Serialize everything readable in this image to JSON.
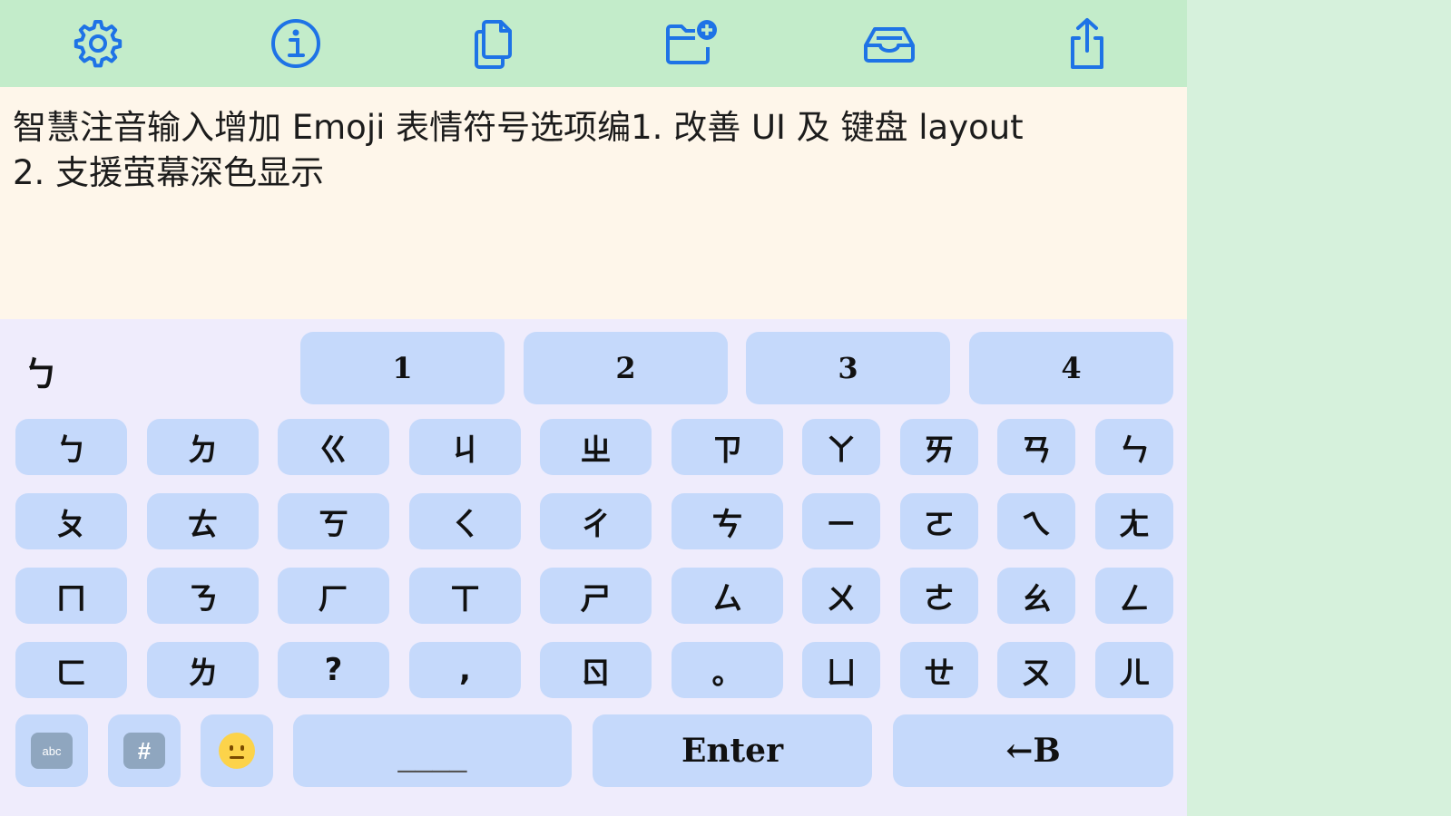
{
  "toolbar": {
    "icons": [
      "gear-icon",
      "info-icon",
      "copy-icon",
      "folder-add-icon",
      "tray-icon",
      "share-icon"
    ],
    "accent_color": "#1e73e6"
  },
  "text_area": {
    "content": "智慧注音输入增加 Emoji 表情符号选项编1. 改善 UI 及 键盘 layout\n2. 支援萤幕深色显示"
  },
  "keyboard": {
    "composition": "ㄅ",
    "candidates": [
      "1",
      "2",
      "3",
      "4"
    ],
    "rows": [
      [
        "ㄅ",
        "ㄉ",
        "ㄍ",
        "ㄐ",
        "ㄓ",
        "ㄗ",
        "ㄚ",
        "ㄞ",
        "ㄢ",
        "ㄣ"
      ],
      [
        "ㄆ",
        "ㄊ",
        "ㄎ",
        "ㄑ",
        "ㄔ",
        "ㄘ",
        "ㄧ",
        "ㄛ",
        "ㄟ",
        "ㄤ"
      ],
      [
        "ㄇ",
        "ㄋ",
        "ㄏ",
        "ㄒ",
        "ㄕ",
        "ㄙ",
        "ㄨ",
        "ㄜ",
        "ㄠ",
        "ㄥ"
      ],
      [
        "ㄈ",
        "ㄌ",
        "?",
        ",",
        "ㄖ",
        "。",
        "ㄩ",
        "ㄝ",
        "ㄡ",
        "ㄦ"
      ]
    ],
    "bottom": {
      "abc_label": "abc",
      "symbols_label": "#",
      "emoji": "🙂",
      "space_label": "____",
      "enter_label": "Enter",
      "backspace_label": "←B"
    }
  }
}
